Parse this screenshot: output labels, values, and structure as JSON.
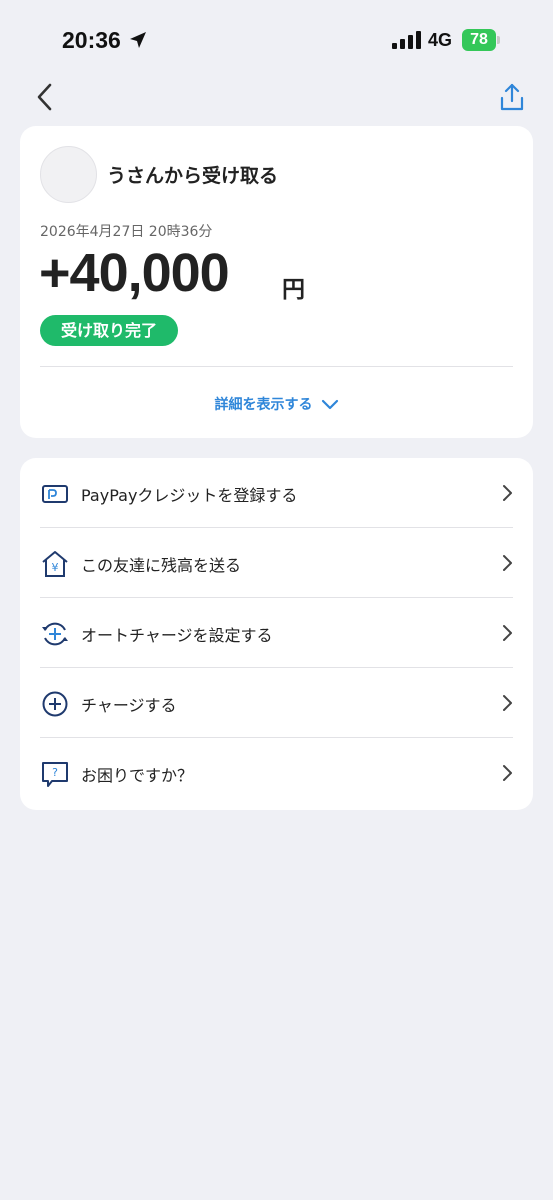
{
  "status_bar": {
    "time": "20:36",
    "network": "4G",
    "battery": "78"
  },
  "icons": {
    "back": "chevron-left-icon",
    "share": "share-icon"
  },
  "transaction": {
    "title": "うさんから受け取る",
    "datetime": "2026年4月27日 20時36分",
    "amount": "+40,000",
    "currency": "円",
    "status": "受け取り完了",
    "details_link": "詳細を表示する"
  },
  "menu": {
    "items": [
      {
        "label": "PayPayクレジットを登録する",
        "icon": "card-icon"
      },
      {
        "label": "この友達に残高を送る",
        "icon": "house-yen-icon"
      },
      {
        "label": "オートチャージを設定する",
        "icon": "auto-charge-icon"
      },
      {
        "label": "チャージする",
        "icon": "plus-circle-icon"
      },
      {
        "label": "お困りですか？",
        "icon": "help-bubble-icon"
      }
    ]
  },
  "colors": {
    "accent": "#2f86d9",
    "success": "#1fba6a",
    "icon": "#1f3a6e",
    "background": "#eff0f5"
  }
}
